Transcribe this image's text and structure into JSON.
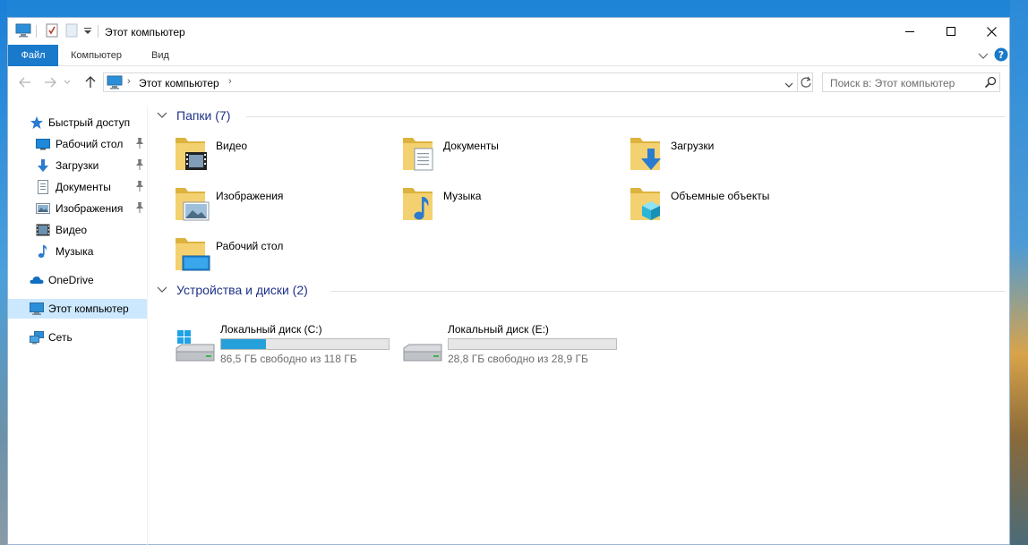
{
  "window": {
    "title": "Этот компьютер"
  },
  "ribbon": {
    "tabs": [
      "Файл",
      "Компьютер",
      "Вид"
    ]
  },
  "address": {
    "path": "Этот компьютер"
  },
  "search": {
    "placeholder": "Поиск в: Этот компьютер"
  },
  "sidebar": {
    "items": [
      {
        "label": "Быстрый доступ",
        "icon": "star-icon"
      },
      {
        "label": "Рабочий стол",
        "icon": "desktop-icon",
        "pinned": true
      },
      {
        "label": "Загрузки",
        "icon": "download-icon",
        "pinned": true
      },
      {
        "label": "Документы",
        "icon": "document-icon",
        "pinned": true
      },
      {
        "label": "Изображения",
        "icon": "picture-icon",
        "pinned": true
      },
      {
        "label": "Видео",
        "icon": "video-icon"
      },
      {
        "label": "Музыка",
        "icon": "music-icon"
      },
      {
        "label": "OneDrive",
        "icon": "cloud-icon"
      },
      {
        "label": "Этот компьютер",
        "icon": "computer-icon",
        "selected": true
      },
      {
        "label": "Сеть",
        "icon": "network-icon"
      }
    ]
  },
  "folders": {
    "header": "Папки (7)",
    "items": [
      {
        "label": "Видео",
        "icon": "video-folder-icon"
      },
      {
        "label": "Документы",
        "icon": "documents-folder-icon"
      },
      {
        "label": "Загрузки",
        "icon": "downloads-folder-icon"
      },
      {
        "label": "Изображения",
        "icon": "pictures-folder-icon"
      },
      {
        "label": "Музыка",
        "icon": "music-folder-icon"
      },
      {
        "label": "Объемные объекты",
        "icon": "3d-objects-folder-icon"
      },
      {
        "label": "Рабочий стол",
        "icon": "desktop-folder-icon"
      }
    ]
  },
  "drives": {
    "header": "Устройства и диски (2)",
    "items": [
      {
        "label": "Локальный диск (C:)",
        "free": "86,5 ГБ свободно из 118 ГБ",
        "used_fraction": 0.27,
        "icon": "windows-drive-icon"
      },
      {
        "label": "Локальный диск (E:)",
        "free": "28,8 ГБ свободно из 28,9 ГБ",
        "used_fraction": 0.0,
        "icon": "drive-icon"
      }
    ]
  },
  "colors": {
    "accent": "#1979ca",
    "header_text": "#1e3287",
    "selection": "#cce8ff",
    "drive_fill": "#26a0da"
  }
}
